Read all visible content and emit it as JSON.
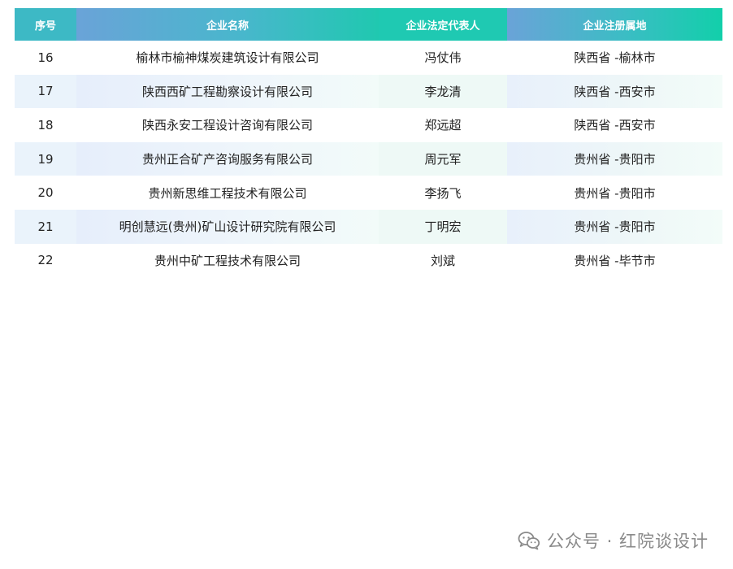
{
  "table": {
    "headers": {
      "seq": "序号",
      "name": "企业名称",
      "rep": "企业法定代表人",
      "loc": "企业注册属地"
    },
    "rows": [
      {
        "seq": "16",
        "name": "榆林市榆神煤炭建筑设计有限公司",
        "rep": "冯仗伟",
        "loc": "陕西省 -榆林市"
      },
      {
        "seq": "17",
        "name": "陕西西矿工程勘察设计有限公司",
        "rep": "李龙清",
        "loc": "陕西省 -西安市"
      },
      {
        "seq": "18",
        "name": "陕西永安工程设计咨询有限公司",
        "rep": "郑远超",
        "loc": "陕西省 -西安市"
      },
      {
        "seq": "19",
        "name": "贵州正合矿产咨询服务有限公司",
        "rep": "周元军",
        "loc": "贵州省 -贵阳市"
      },
      {
        "seq": "20",
        "name": "贵州新思维工程技术有限公司",
        "rep": "李扬飞",
        "loc": "贵州省 -贵阳市"
      },
      {
        "seq": "21",
        "name": "明创慧远(贵州)矿山设计研究院有限公司",
        "rep": "丁明宏",
        "loc": "贵州省 -贵阳市"
      },
      {
        "seq": "22",
        "name": "贵州中矿工程技术有限公司",
        "rep": "刘斌",
        "loc": "贵州省 -毕节市"
      }
    ]
  },
  "watermark": {
    "text": "公众号 · 红院谈设计",
    "icon": "wechat-icon"
  }
}
